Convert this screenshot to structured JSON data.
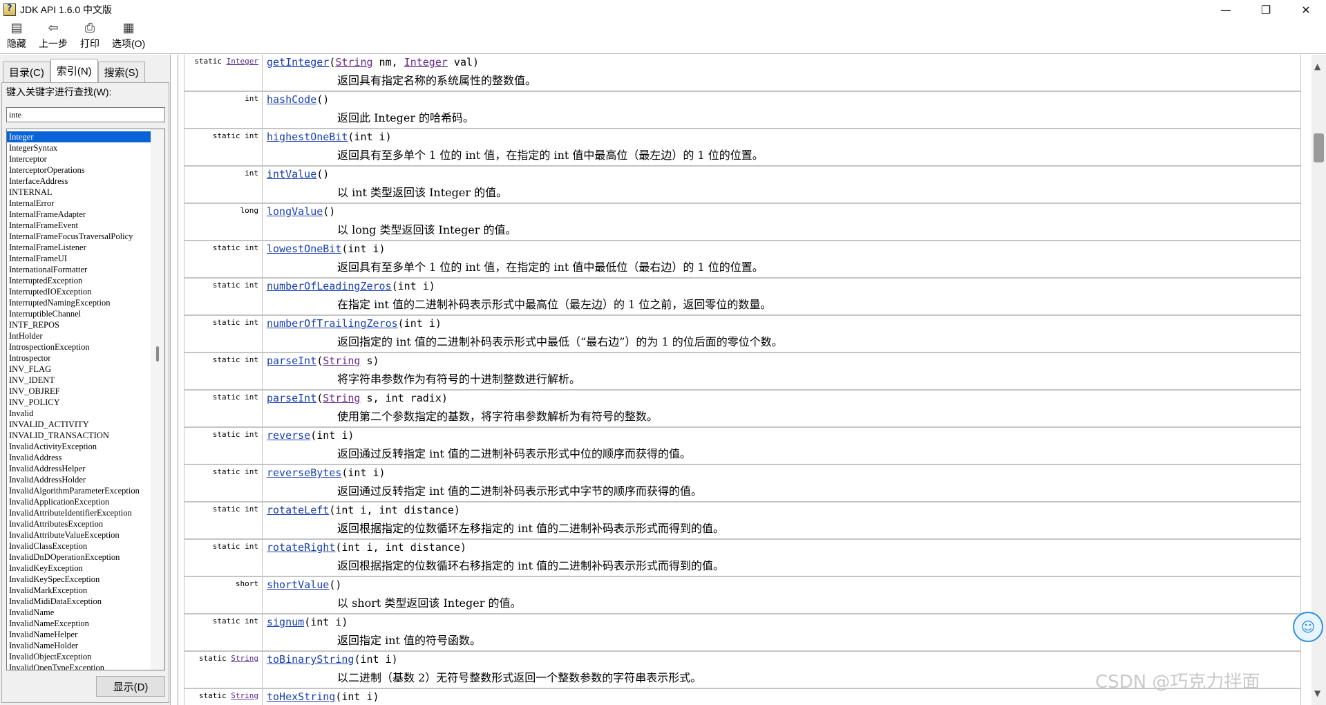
{
  "window": {
    "title": "JDK API 1.6.0 中文版",
    "controls": {
      "minimize": "—",
      "restore": "❐",
      "close": "✕"
    }
  },
  "toolbar": [
    {
      "icon": "▤",
      "label": "隐藏"
    },
    {
      "icon": "⇦",
      "label": "上一步"
    },
    {
      "icon": "⎙",
      "label": "打印"
    },
    {
      "icon": "▦",
      "label": "选项(O)"
    }
  ],
  "left_pane": {
    "tabs": [
      {
        "label": "目录(C)",
        "active": false
      },
      {
        "label": "索引(N)",
        "active": true
      },
      {
        "label": "搜索(S)",
        "active": false
      }
    ],
    "search_label": "键入关键字进行查找(W):",
    "search_value": "inte",
    "display_button": "显示(D)",
    "items": [
      "Integer",
      "IntegerSyntax",
      "Interceptor",
      "InterceptorOperations",
      "InterfaceAddress",
      "INTERNAL",
      "InternalError",
      "InternalFrameAdapter",
      "InternalFrameEvent",
      "InternalFrameFocusTraversalPolicy",
      "InternalFrameListener",
      "InternalFrameUI",
      "InternationalFormatter",
      "InterruptedException",
      "InterruptedIOException",
      "InterruptedNamingException",
      "InterruptibleChannel",
      "INTF_REPOS",
      "IntHolder",
      "IntrospectionException",
      "Introspector",
      "INV_FLAG",
      "INV_IDENT",
      "INV_OBJREF",
      "INV_POLICY",
      "Invalid",
      "INVALID_ACTIVITY",
      "INVALID_TRANSACTION",
      "InvalidActivityException",
      "InvalidAddress",
      "InvalidAddressHelper",
      "InvalidAddressHolder",
      "InvalidAlgorithmParameterException",
      "InvalidApplicationException",
      "InvalidAttributeIdentifierException",
      "InvalidAttributesException",
      "InvalidAttributeValueException",
      "InvalidClassException",
      "InvalidDnDOperationException",
      "InvalidKeyException",
      "InvalidKeySpecException",
      "InvalidMarkException",
      "InvalidMidiDataException",
      "InvalidName",
      "InvalidNameException",
      "InvalidNameHelper",
      "InvalidNameHolder",
      "InvalidObjectException",
      "InvalidOpenTypeException"
    ],
    "selected_index": 0
  },
  "methods": [
    {
      "modifier": "static",
      "modifier_type": "Integer",
      "name": "getInteger",
      "params": [
        [
          "String",
          " nm, "
        ],
        [
          "Integer",
          " val)"
        ]
      ],
      "params_plain": "",
      "desc": "返回具有指定名称的系统属性的整数值。"
    },
    {
      "modifier": "int",
      "modifier_type": "",
      "name": "hashCode",
      "params": [],
      "params_plain": "()",
      "desc": "返回此 Integer 的哈希码。"
    },
    {
      "modifier": "static int",
      "modifier_type": "",
      "name": "highestOneBit",
      "params": [],
      "params_plain": "(int i)",
      "desc": "返回具有至多单个 1 位的 int 值，在指定的 int 值中最高位（最左边）的 1 位的位置。"
    },
    {
      "modifier": "int",
      "modifier_type": "",
      "name": "intValue",
      "params": [],
      "params_plain": "()",
      "desc": "以 int 类型返回该 Integer 的值。"
    },
    {
      "modifier": "long",
      "modifier_type": "",
      "name": "longValue",
      "params": [],
      "params_plain": "()",
      "desc": "以 long 类型返回该 Integer 的值。"
    },
    {
      "modifier": "static int",
      "modifier_type": "",
      "name": "lowestOneBit",
      "params": [],
      "params_plain": "(int i)",
      "desc": "返回具有至多单个 1 位的 int 值，在指定的 int 值中最低位（最右边）的 1 位的位置。"
    },
    {
      "modifier": "static int",
      "modifier_type": "",
      "name": "numberOfLeadingZeros",
      "params": [],
      "params_plain": "(int i)",
      "desc": "在指定 int 值的二进制补码表示形式中最高位（最左边）的 1 位之前，返回零位的数量。"
    },
    {
      "modifier": "static int",
      "modifier_type": "",
      "name": "numberOfTrailingZeros",
      "params": [],
      "params_plain": "(int i)",
      "desc": "返回指定的 int 值的二进制补码表示形式中最低（“最右边”）的为 1 的位后面的零位个数。"
    },
    {
      "modifier": "static int",
      "modifier_type": "",
      "name": "parseInt",
      "params": [
        [
          "String",
          " s)"
        ]
      ],
      "params_plain": "",
      "desc": "将字符串参数作为有符号的十进制整数进行解析。"
    },
    {
      "modifier": "static int",
      "modifier_type": "",
      "name": "parseInt",
      "params": [
        [
          "String",
          " s, int radix)"
        ]
      ],
      "params_plain": "",
      "desc": "使用第二个参数指定的基数，将字符串参数解析为有符号的整数。"
    },
    {
      "modifier": "static int",
      "modifier_type": "",
      "name": "reverse",
      "params": [],
      "params_plain": "(int i)",
      "desc": "返回通过反转指定 int 值的二进制补码表示形式中位的顺序而获得的值。"
    },
    {
      "modifier": "static int",
      "modifier_type": "",
      "name": "reverseBytes",
      "params": [],
      "params_plain": "(int i)",
      "desc": "返回通过反转指定 int 值的二进制补码表示形式中字节的顺序而获得的值。"
    },
    {
      "modifier": "static int",
      "modifier_type": "",
      "name": "rotateLeft",
      "params": [],
      "params_plain": "(int i, int distance)",
      "desc": "返回根据指定的位数循环左移指定的 int 值的二进制补码表示形式而得到的值。"
    },
    {
      "modifier": "static int",
      "modifier_type": "",
      "name": "rotateRight",
      "params": [],
      "params_plain": "(int i, int distance)",
      "desc": "返回根据指定的位数循环右移指定的 int 值的二进制补码表示形式而得到的值。"
    },
    {
      "modifier": "short",
      "modifier_type": "",
      "name": "shortValue",
      "params": [],
      "params_plain": "()",
      "desc": "以 short 类型返回该 Integer 的值。"
    },
    {
      "modifier": "static int",
      "modifier_type": "",
      "name": "signum",
      "params": [],
      "params_plain": "(int i)",
      "desc": "返回指定 int 值的符号函数。"
    },
    {
      "modifier": "static",
      "modifier_type": "String",
      "name": "toBinaryString",
      "params": [],
      "params_plain": "(int i)",
      "desc": "以二进制（基数 2）无符号整数形式返回一个整数参数的字符串表示形式。"
    },
    {
      "modifier": "static",
      "modifier_type": "String",
      "name": "toHexString",
      "params": [],
      "params_plain": "(int i)",
      "desc": ""
    }
  ],
  "watermark": "CSDN @巧克力拌面"
}
